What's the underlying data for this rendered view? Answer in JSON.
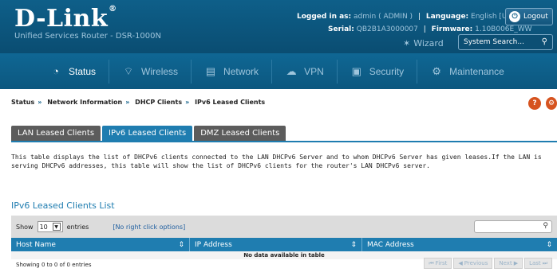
{
  "header": {
    "logo": "D-Link",
    "product": "Unified Services Router - DSR-1000N",
    "logged_in_label": "Logged in as:",
    "logged_in_value": "admin ( ADMIN )",
    "language_label": "Language:",
    "language_value": "English [US]",
    "serial_label": "Serial:",
    "serial_value": "QB2B1A3000007",
    "firmware_label": "Firmware:",
    "firmware_value": "1.10B006E_WW",
    "logout": "Logout",
    "wizard": "Wizard",
    "search_placeholder": "System Search..."
  },
  "nav": {
    "items": [
      {
        "label": "Status",
        "icon": "gauge-icon"
      },
      {
        "label": "Wireless",
        "icon": "wifi-icon"
      },
      {
        "label": "Network",
        "icon": "network-icon"
      },
      {
        "label": "VPN",
        "icon": "cloud-icon"
      },
      {
        "label": "Security",
        "icon": "lock-icon"
      },
      {
        "label": "Maintenance",
        "icon": "gears-icon"
      }
    ]
  },
  "breadcrumb": [
    "Status",
    "Network Information",
    "DHCP Clients",
    "IPv6 Leased Clients"
  ],
  "tabs": [
    "LAN Leased Clients",
    "IPv6 Leased Clients",
    "DMZ Leased Clients"
  ],
  "description": "This table displays the list of DHCPv6 clients connected to the LAN DHCPv6 Server and to whom DHCPv6 Server has given leases.If the LAN is serving DHCPv6 addresses, this table will show the list of DHCPv6 clients for the router's LAN DHCPv6 server.",
  "list_title": "IPv6 Leased Clients List",
  "table": {
    "show_label": "Show",
    "show_value": "10",
    "entries_label": "entries",
    "options_link": "[No right click options]",
    "columns": [
      "Host Name",
      "IP Address",
      "MAC Address"
    ],
    "empty": "No data available in table",
    "info": "Showing 0 to 0 of 0 entries",
    "pager": [
      "First",
      "Previous",
      "Next",
      "Last"
    ]
  }
}
